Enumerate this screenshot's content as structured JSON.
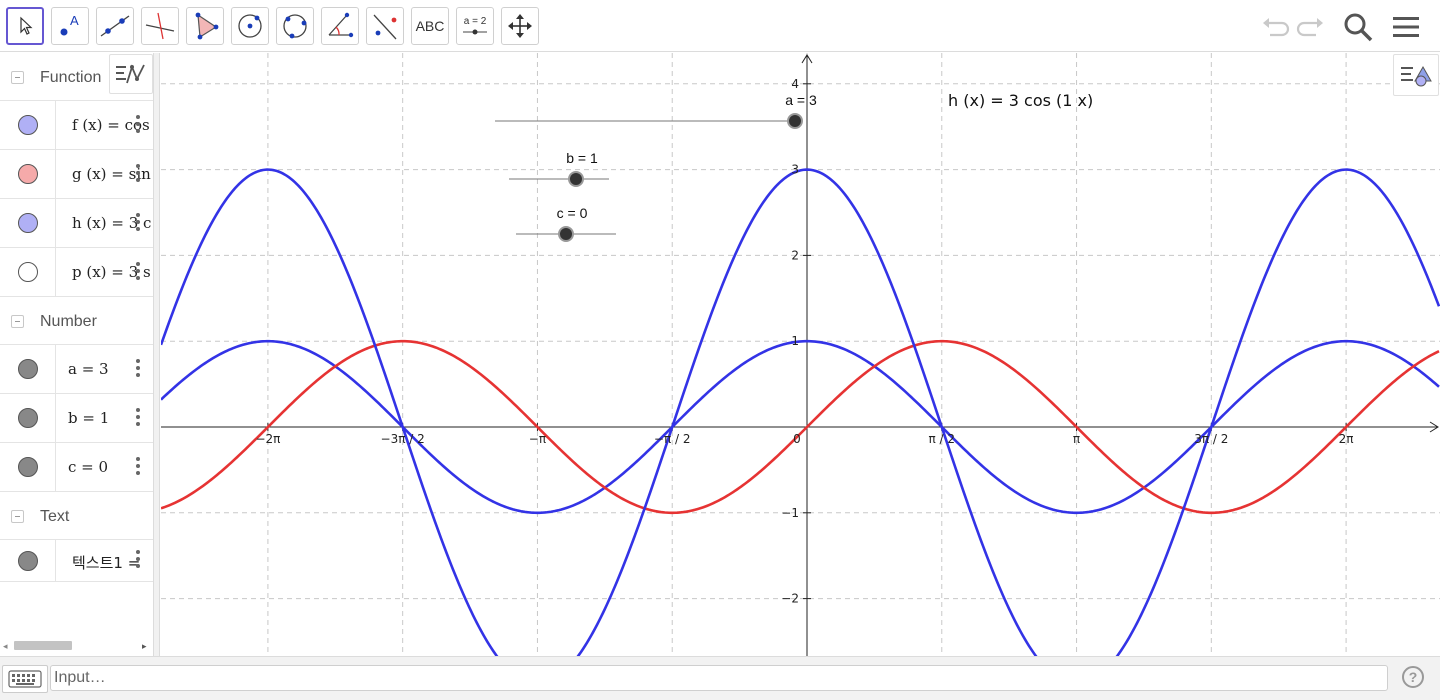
{
  "toolbar": {
    "tools": [
      {
        "name": "move-tool",
        "icon": "pointer-arrow-icon",
        "active": true
      },
      {
        "name": "point-tool",
        "icon": "point-icon"
      },
      {
        "name": "line-tool",
        "icon": "line-through-two-points-icon"
      },
      {
        "name": "perpendicular-line-tool",
        "icon": "perpendicular-line-icon"
      },
      {
        "name": "polygon-tool",
        "icon": "polygon-icon"
      },
      {
        "name": "circle-center-point-tool",
        "icon": "circle-center-point-icon"
      },
      {
        "name": "circle-three-points-tool",
        "icon": "circle-three-points-icon"
      },
      {
        "name": "angle-tool",
        "icon": "angle-icon"
      },
      {
        "name": "reflect-tool",
        "icon": "reflect-about-line-icon"
      },
      {
        "name": "text-tool",
        "label": "ABC"
      },
      {
        "name": "slider-tool",
        "label": "a = 2"
      },
      {
        "name": "move-graphics-view-tool",
        "icon": "move-arrows-icon"
      }
    ],
    "undo_icon": "undo-icon",
    "redo_icon": "redo-icon",
    "search_icon": "search-icon",
    "menu_icon": "hamburger-menu-icon"
  },
  "algebra": {
    "groups": [
      {
        "title": "Function",
        "items": [
          {
            "label": "f (x)  =  cos",
            "color": "#b0b0f5"
          },
          {
            "label": "g (x)  =  sin",
            "color": "#f5aaaa"
          },
          {
            "label": "h (x)  =  3  c",
            "color": "#b0b0f5"
          },
          {
            "label": "p (x)  =  3  s",
            "color": "#ffffff"
          }
        ]
      },
      {
        "title": "Number",
        "items": [
          {
            "label": "a  =  3",
            "color": "#888888"
          },
          {
            "label": "b  =  1",
            "color": "#888888"
          },
          {
            "label": "c  =  0",
            "color": "#888888"
          }
        ]
      },
      {
        "title": "Text",
        "items": [
          {
            "label": "텍스트1  =",
            "color": "#888888"
          }
        ]
      }
    ]
  },
  "graphics": {
    "sliders": [
      {
        "label": "a = 3",
        "name": "slider-a"
      },
      {
        "label": "b = 1",
        "name": "slider-b"
      },
      {
        "label": "c = 0",
        "name": "slider-c"
      }
    ],
    "h_text": "h (x)  =  3  cos (1 x)",
    "x_tick_labels": [
      "−2π",
      "−3π / 2",
      "−π",
      "−π / 2",
      "0",
      "π / 2",
      "π",
      "3π / 2",
      "2π"
    ],
    "y_tick_labels": [
      "4",
      "3",
      "2",
      "1",
      "−1",
      "−2"
    ]
  },
  "chart_data": {
    "type": "line",
    "title": "",
    "xlabel": "",
    "ylabel": "",
    "xlim": [
      -7.3,
      11.3
    ],
    "ylim": [
      -2.65,
      4.4
    ],
    "grid": true,
    "series": [
      {
        "name": "f(x) = cos(x)",
        "expr": "cos",
        "amplitude": 1,
        "color": "#3333e6"
      },
      {
        "name": "g(x) = sin(x)",
        "expr": "sin",
        "amplitude": 1,
        "color": "#e63333"
      },
      {
        "name": "h(x) = 3 cos(1 x)",
        "expr": "cos",
        "amplitude": 3,
        "color": "#3333e6"
      }
    ],
    "x_ticks": [
      -6.2832,
      -4.7124,
      -3.1416,
      -1.5708,
      0,
      1.5708,
      3.1416,
      4.7124,
      6.2832
    ],
    "y_ticks": [
      4,
      3,
      2,
      1,
      -1,
      -2
    ]
  },
  "input": {
    "placeholder": "Input…",
    "keyboard_icon": "keyboard-icon",
    "help_icon": "help-icon"
  }
}
